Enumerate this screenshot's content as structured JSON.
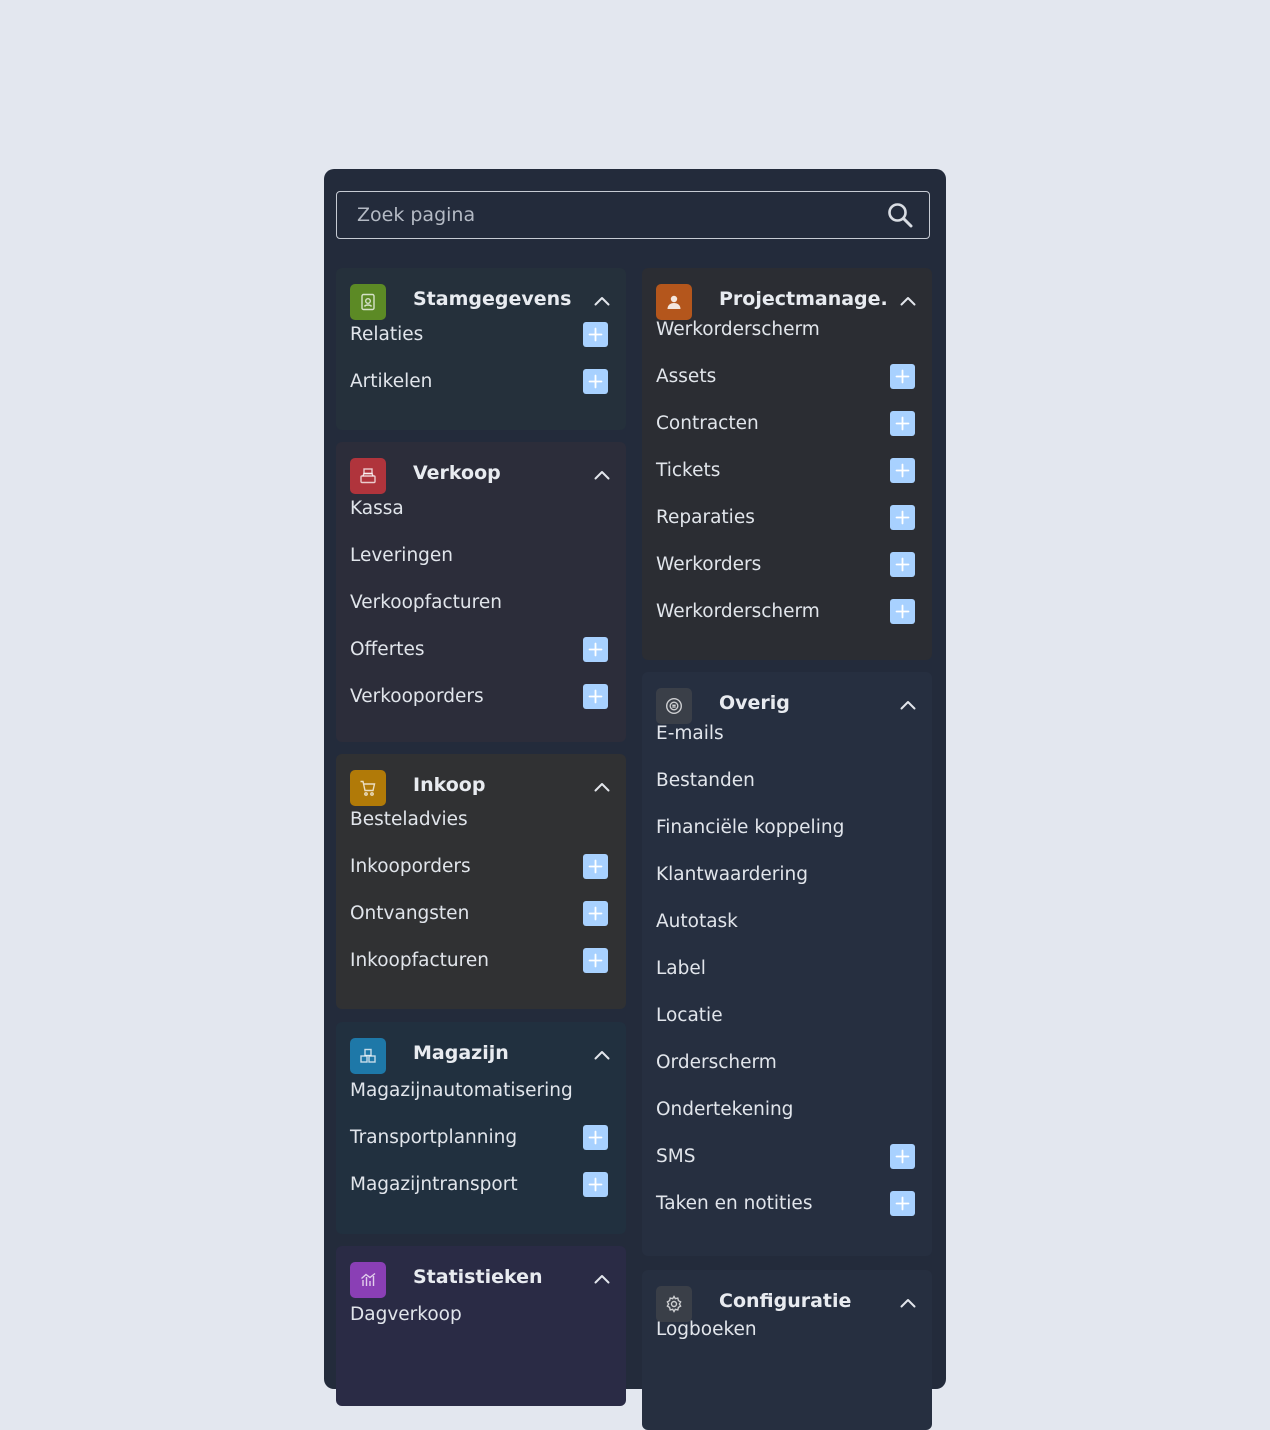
{
  "search": {
    "placeholder": "Zoek pagina"
  },
  "colors": {
    "background": "#e3e7ef",
    "panel": "#232b3b",
    "add_button": "#a8d1ff",
    "stamgegevens_icon": "#5c8a25",
    "verkoop_icon": "#b0343c",
    "inkoop_icon": "#b17a08",
    "magazijn_icon": "#1e78a8",
    "statistieken_icon": "#8a3fb5",
    "projectmanagement_icon": "#b4561c",
    "overig_icon": "#3a3f48",
    "configuratie_icon": "#3a3f48"
  },
  "left_column": [
    {
      "title": "Stamgegevens",
      "icon": "contact-card-icon",
      "items": [
        {
          "label": "Relaties",
          "add": true
        },
        {
          "label": "Artikelen",
          "add": true
        }
      ]
    },
    {
      "title": "Verkoop",
      "icon": "cash-register-icon",
      "items": [
        {
          "label": "Kassa",
          "add": false
        },
        {
          "label": "Leveringen",
          "add": false
        },
        {
          "label": "Verkoopfacturen",
          "add": false
        },
        {
          "label": "Offertes",
          "add": true
        },
        {
          "label": "Verkooporders",
          "add": true
        }
      ]
    },
    {
      "title": "Inkoop",
      "icon": "shopping-cart-icon",
      "items": [
        {
          "label": "Besteladvies",
          "add": false
        },
        {
          "label": "Inkooporders",
          "add": true
        },
        {
          "label": "Ontvangsten",
          "add": true
        },
        {
          "label": "Inkoopfacturen",
          "add": true
        }
      ]
    },
    {
      "title": "Magazijn",
      "icon": "warehouse-boxes-icon",
      "items": [
        {
          "label": "Magazijnautomatisering",
          "add": false
        },
        {
          "label": "Transportplanning",
          "add": true
        },
        {
          "label": "Magazijntransport",
          "add": true
        }
      ]
    },
    {
      "title": "Statistieken",
      "icon": "bar-chart-icon",
      "items": [
        {
          "label": "Dagverkoop",
          "add": false
        }
      ]
    }
  ],
  "right_column": [
    {
      "title": "Projectmanage.",
      "icon": "worker-person-icon",
      "items": [
        {
          "label": "Werkorderscherm",
          "add": false
        },
        {
          "label": "Assets",
          "add": true
        },
        {
          "label": "Contracten",
          "add": true
        },
        {
          "label": "Tickets",
          "add": true
        },
        {
          "label": "Reparaties",
          "add": true
        },
        {
          "label": "Werkorders",
          "add": true
        },
        {
          "label": "Werkorderscherm",
          "add": true
        }
      ]
    },
    {
      "title": "Overig",
      "icon": "robot-face-icon",
      "items": [
        {
          "label": "E-mails",
          "add": false
        },
        {
          "label": "Bestanden",
          "add": false
        },
        {
          "label": "Financiële koppeling",
          "add": false
        },
        {
          "label": "Klantwaardering",
          "add": false
        },
        {
          "label": "Autotask",
          "add": false
        },
        {
          "label": "Label",
          "add": false
        },
        {
          "label": "Locatie",
          "add": false
        },
        {
          "label": "Orderscherm",
          "add": false
        },
        {
          "label": "Ondertekening",
          "add": false
        },
        {
          "label": "SMS",
          "add": true
        },
        {
          "label": "Taken en notities",
          "add": true
        }
      ]
    },
    {
      "title": "Configuratie",
      "icon": "gear-icon",
      "items": [
        {
          "label": "Logboeken",
          "add": false
        }
      ]
    }
  ]
}
